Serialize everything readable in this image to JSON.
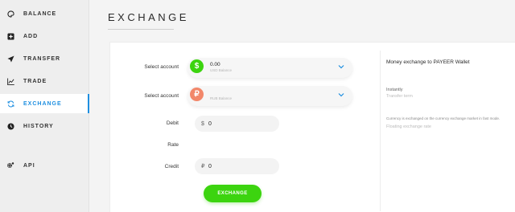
{
  "sidebar": {
    "items": [
      {
        "label": "BALANCE",
        "icon": "palette-icon"
      },
      {
        "label": "ADD",
        "icon": "plus-square-icon"
      },
      {
        "label": "TRANSFER",
        "icon": "send-icon"
      },
      {
        "label": "TRADE",
        "icon": "chart-icon"
      },
      {
        "label": "EXCHANGE",
        "icon": "refresh-icon",
        "active": true
      },
      {
        "label": "HISTORY",
        "icon": "clock-icon"
      },
      {
        "label": "API",
        "icon": "gear-icon"
      }
    ]
  },
  "page": {
    "title": "EXCHANGE"
  },
  "form": {
    "select_from_label": "Select account",
    "select_from_value": "0.00",
    "select_from_sub": "USD Balance",
    "select_from_symbol": "$",
    "select_to_label": "Select account",
    "select_to_value": "",
    "select_to_sub": "RUB Balance",
    "select_to_symbol": "₽",
    "debit_label": "Debit",
    "debit_currency": "$",
    "debit_value": "0",
    "rate_label": "Rate",
    "credit_label": "Credit",
    "credit_currency": "₽",
    "credit_value": "0",
    "submit_label": "EXCHANGE"
  },
  "info": {
    "title": "Money exchange to PAYEER Wallet",
    "instantly_label": "Instantly",
    "instantly_sub": "Transfer term",
    "note": "Currency is exchanged on the currency exchange market in fast mode.",
    "note_sub": "Floating exchange rate"
  },
  "colors": {
    "accent": "#1f8fe0",
    "usd_coin": "#3cd40f",
    "rub_coin": "#f2876a",
    "button": "#3cd40f"
  }
}
